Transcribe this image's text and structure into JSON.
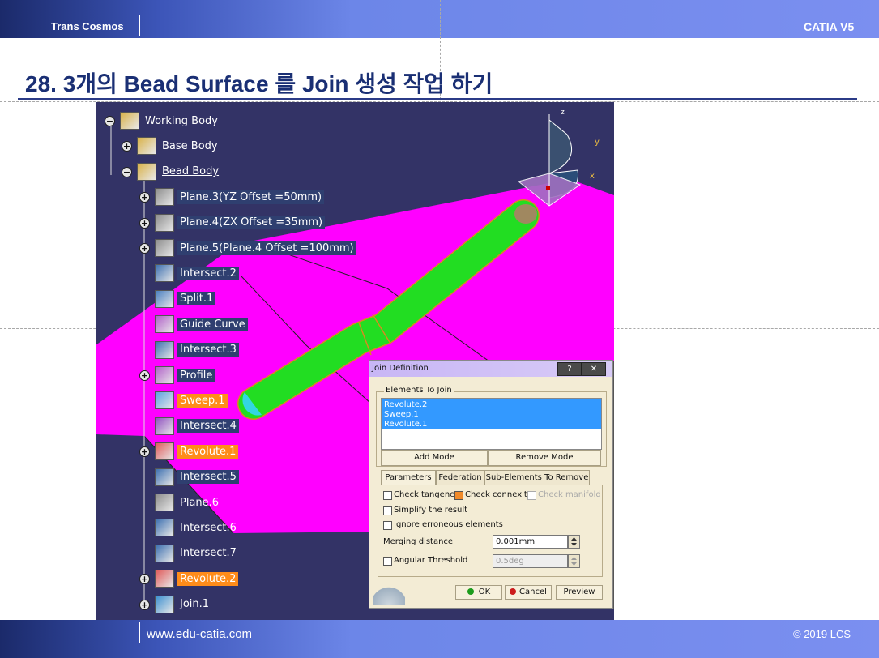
{
  "header": {
    "left_text": "Trans Cosmos",
    "right_text": "CATIA V5"
  },
  "footer": {
    "left_text": "www.edu-catia.com",
    "right_text": "© 2019 LCS"
  },
  "slide": {
    "title": "28. 3개의 Bead Surface 를 Join 생성 작업 하기"
  },
  "compass": {
    "x": "x",
    "y": "y",
    "z": "z"
  },
  "tree": {
    "items": [
      {
        "label": "Working Body",
        "style": "plain"
      },
      {
        "label": "Base Body",
        "style": "plain"
      },
      {
        "label": "Bead Body",
        "style": "underline"
      },
      {
        "label": "Plane.3(YZ Offset =50mm)",
        "style": "highlight"
      },
      {
        "label": "Plane.4(ZX Offset =35mm)",
        "style": "highlight"
      },
      {
        "label": "Plane.5(Plane.4 Offset =100mm)",
        "style": "highlight"
      },
      {
        "label": "Intersect.2",
        "style": "highlight"
      },
      {
        "label": "Split.1",
        "style": "highlight"
      },
      {
        "label": "Guide Curve",
        "style": "highlight"
      },
      {
        "label": "Intersect.3",
        "style": "highlight"
      },
      {
        "label": "Profile",
        "style": "highlight"
      },
      {
        "label": "Sweep.1",
        "style": "orange"
      },
      {
        "label": "Intersect.4",
        "style": "highlight"
      },
      {
        "label": "Revolute.1",
        "style": "orange"
      },
      {
        "label": "Intersect.5",
        "style": "highlight"
      },
      {
        "label": "Plane.6",
        "style": "plain"
      },
      {
        "label": "Intersect.6",
        "style": "plain"
      },
      {
        "label": "Intersect.7",
        "style": "plain"
      },
      {
        "label": "Revolute.2",
        "style": "orange"
      },
      {
        "label": "Join.1",
        "style": "plain"
      }
    ]
  },
  "dialog": {
    "title": "Join Definition",
    "help_label": "?",
    "close_label": "✕",
    "elements_group_label": "Elements To Join",
    "elements": [
      "Revolute.2",
      "Sweep.1",
      "Revolute.1"
    ],
    "add_mode_label": "Add Mode",
    "remove_mode_label": "Remove Mode",
    "tabs": [
      "Parameters",
      "Federation",
      "Sub-Elements To Remove"
    ],
    "check_tangency_label": "Check tangency",
    "check_connexity_label": "Check connexity",
    "check_manifold_label": "Check manifold",
    "simplify_label": "Simplify the result",
    "ignore_label": "Ignore erroneous elements",
    "merging_label": "Merging distance",
    "merging_value": "0.001mm",
    "angular_label": "Angular Threshold",
    "angular_value": "0.5deg",
    "ok_label": "OK",
    "cancel_label": "Cancel",
    "preview_label": "Preview"
  },
  "colors": {
    "surface": "#ff00ff",
    "tube": "#22dd22",
    "viewport_bg": "#333366",
    "title": "#1a2f74",
    "highlight_orange": "#ff8c1a",
    "selection_blue": "#3399ff"
  }
}
